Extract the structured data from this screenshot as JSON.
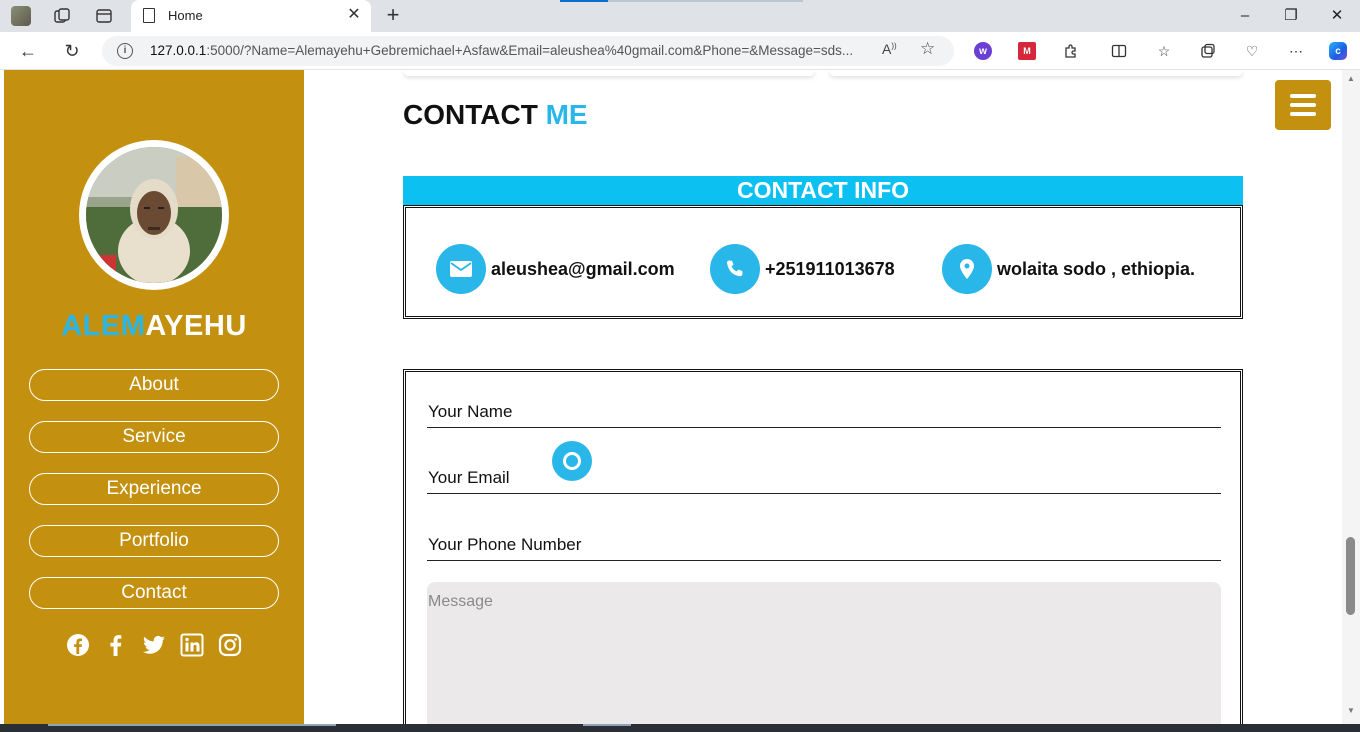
{
  "browser": {
    "tab_title": "Home",
    "url_host": "127.0.0.1",
    "url_rest": ":5000/?Name=Alemayehu+Gebremichael+Asfaw&Email=aleushea%40gmail.com&Phone=&Message=sds...",
    "read_aloud_label": "A⁾"
  },
  "sidebar": {
    "brand_part1": "ALEM",
    "brand_part2": "AYEHU",
    "nav": [
      {
        "label": "About"
      },
      {
        "label": "Service"
      },
      {
        "label": "Experience"
      },
      {
        "label": "Portfolio"
      },
      {
        "label": "Contact"
      }
    ],
    "socials": [
      "facebook-circle-icon",
      "facebook-icon",
      "twitter-icon",
      "linkedin-icon",
      "instagram-icon"
    ]
  },
  "contact": {
    "title_part1": "CONTACT",
    "title_part2": "ME",
    "info_heading": "CONTACT INFO",
    "email": "aleushea@gmail.com",
    "phone": "+251911013678",
    "location": "wolaita sodo , ethiopia."
  },
  "form": {
    "name_label": "Your Name",
    "email_label": "Your Email",
    "phone_label": "Your Phone Number",
    "message_placeholder": "Message"
  },
  "colors": {
    "sidebar_bg": "#c39010",
    "accent_blue": "#29b6e8",
    "banner_blue": "#0cc1f2"
  }
}
